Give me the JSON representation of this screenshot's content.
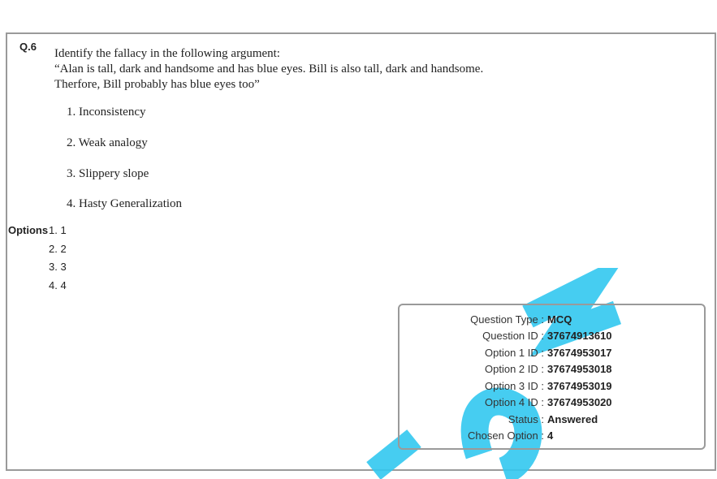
{
  "question": {
    "number": "Q.6",
    "lines": [
      "Identify the fallacy in the following argument:",
      "“Alan is tall, dark and handsome and has blue eyes. Bill is also tall, dark and handsome.",
      "Therfore, Bill probably has blue eyes too”"
    ],
    "choices": [
      "1. Inconsistency",
      "2. Weak analogy",
      "3. Slippery slope",
      "4. Hasty Generalization"
    ]
  },
  "options": {
    "label": "Options",
    "items": [
      "1. 1",
      "2. 2",
      "3. 3",
      "4. 4"
    ]
  },
  "info": {
    "rows": [
      {
        "key": "Question Type :",
        "value": "MCQ"
      },
      {
        "key": "Question ID :",
        "value": "37674913610"
      },
      {
        "key": "Option 1 ID :",
        "value": "37674953017"
      },
      {
        "key": "Option 2 ID :",
        "value": "37674953018"
      },
      {
        "key": "Option 3 ID :",
        "value": "37674953019"
      },
      {
        "key": "Option 4 ID :",
        "value": "37674953020"
      },
      {
        "key": "Status :",
        "value": "Answered"
      },
      {
        "key": "Chosen Option :",
        "value": "4"
      }
    ]
  },
  "colors": {
    "watermark": "#32c8f0",
    "border": "#9a9a9a"
  }
}
